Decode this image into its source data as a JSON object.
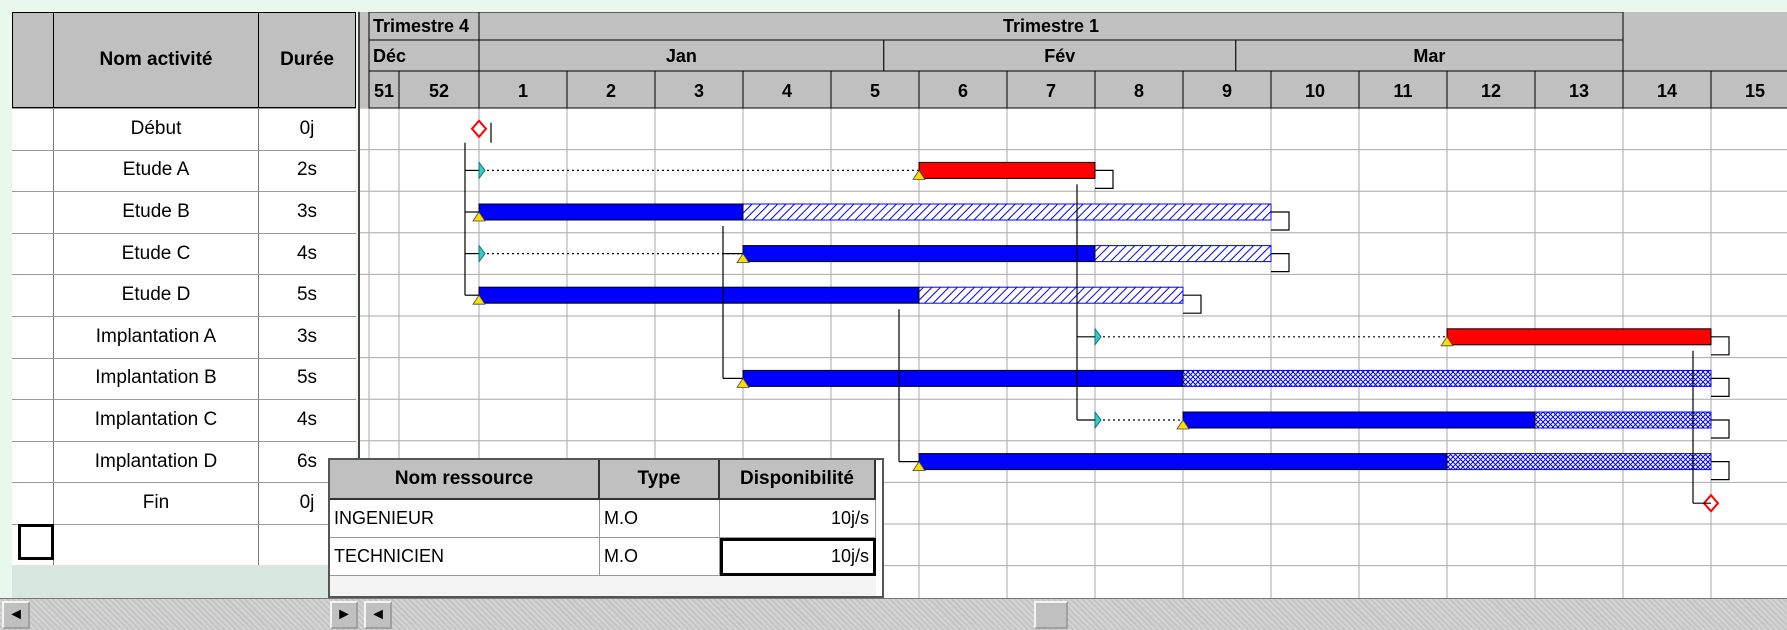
{
  "activity_table": {
    "col_name": "Nom activité",
    "col_duration": "Durée",
    "rows": [
      {
        "name": "Début",
        "duration": "0j"
      },
      {
        "name": "Etude A",
        "duration": "2s"
      },
      {
        "name": "Etude B",
        "duration": "3s"
      },
      {
        "name": "Etude C",
        "duration": "4s"
      },
      {
        "name": "Etude D",
        "duration": "5s"
      },
      {
        "name": "Implantation A",
        "duration": "3s"
      },
      {
        "name": "Implantation B",
        "duration": "5s"
      },
      {
        "name": "Implantation C",
        "duration": "4s"
      },
      {
        "name": "Implantation D",
        "duration": "6s"
      },
      {
        "name": "Fin",
        "duration": "0j"
      }
    ]
  },
  "timescale": {
    "quarters": [
      {
        "label": "Trimestre 4",
        "start_week_index": 0,
        "span": 2
      },
      {
        "label": "Trimestre 1",
        "start_week_index": 2,
        "span": 13
      }
    ],
    "months": [
      {
        "label": "Déc",
        "start_week_index": 0,
        "span": 2
      },
      {
        "label": "Jan",
        "start_week_index": 2,
        "span": 4.6
      },
      {
        "label": "Fév",
        "start_week_index": 6.6,
        "span": 4
      },
      {
        "label": "Mar",
        "start_week_index": 10.6,
        "span": 4.4
      }
    ],
    "weeks": [
      "51",
      "52",
      "1",
      "2",
      "3",
      "4",
      "5",
      "6",
      "7",
      "8",
      "9",
      "10",
      "11",
      "12",
      "13",
      "14",
      "15"
    ]
  },
  "tasks": [
    {
      "type": "milestone",
      "start": 1.0
    },
    {
      "type": "bar",
      "color": "red",
      "es": 1.0,
      "start": 6.0,
      "end": 8.0,
      "slack_end": 8.0
    },
    {
      "type": "bar",
      "color": "blue",
      "es": 1.0,
      "start": 1.0,
      "end": 4.0,
      "slack_end": 10.0,
      "slack_pattern": "diag"
    },
    {
      "type": "bar",
      "color": "blue",
      "es": 1.0,
      "start": 4.0,
      "end": 8.0,
      "slack_end": 10.0,
      "slack_pattern": "diag"
    },
    {
      "type": "bar",
      "color": "blue",
      "es": 1.0,
      "start": 1.0,
      "end": 6.0,
      "slack_end": 9.0,
      "slack_pattern": "diag"
    },
    {
      "type": "bar",
      "color": "red",
      "es": 8.0,
      "start": 12.0,
      "end": 15.0,
      "slack_end": 15.0
    },
    {
      "type": "bar",
      "color": "blue",
      "es": 4.0,
      "start": 4.0,
      "end": 9.0,
      "slack_end": 15.0,
      "slack_pattern": "cross"
    },
    {
      "type": "bar",
      "color": "blue",
      "es": 8.0,
      "start": 9.0,
      "end": 13.0,
      "slack_end": 15.0,
      "slack_pattern": "cross"
    },
    {
      "type": "bar",
      "color": "blue",
      "es": 6.0,
      "start": 6.0,
      "end": 12.0,
      "slack_end": 15.0,
      "slack_pattern": "cross"
    },
    {
      "type": "milestone",
      "start": 15.0
    }
  ],
  "resource_table": {
    "col_name": "Nom ressource",
    "col_type": "Type",
    "col_availability": "Disponibilité",
    "rows": [
      {
        "name": "INGENIEUR",
        "type": "M.O",
        "availability": "10j/s"
      },
      {
        "name": "TECHNICIEN",
        "type": "M.O",
        "availability": "10j/s"
      }
    ]
  },
  "colors": {
    "critical_bar": "#ff0000",
    "normal_bar": "#0000ff",
    "slack_pattern": "#0000ff",
    "milestone": "#ff0000",
    "early_start_marker": "#ffdd00",
    "link_marker": "#33cccc",
    "header_gray": "#c0c0c0"
  },
  "scrollbars": {
    "left_arrow": "◄",
    "right_arrow": "►"
  }
}
